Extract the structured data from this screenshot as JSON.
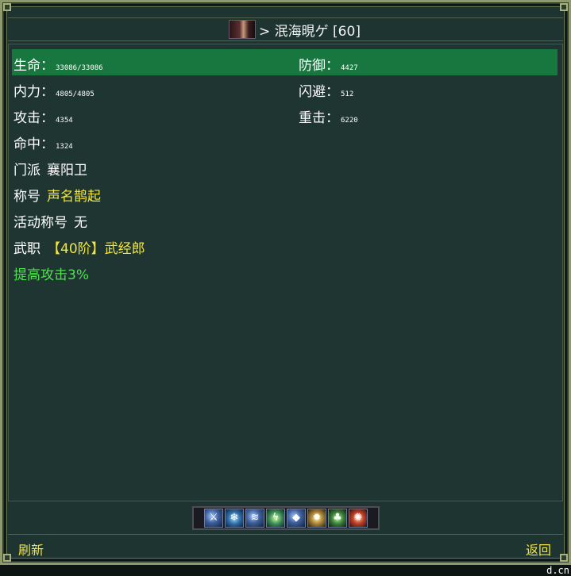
{
  "title": {
    "name": "> 泯海晛ゲ [60]"
  },
  "stats": {
    "hp_label": "生命：",
    "hp_value": "33086/33086",
    "defense_label": "防御：",
    "defense_value": "4427",
    "mp_label": "内力：",
    "mp_value": "4805/4805",
    "dodge_label": "闪避：",
    "dodge_value": "512",
    "attack_label": "攻击：",
    "attack_value": "4354",
    "crit_label": "重击：",
    "crit_value": "6220",
    "hit_label": "命中：",
    "hit_value": "1324"
  },
  "info": {
    "sect_label": "门派",
    "sect_value": "襄阳卫",
    "title_label": "称号",
    "title_value": "声名鹊起",
    "event_title_label": "活动称号",
    "event_title_value": "无",
    "rank_label": "武职",
    "rank_value": "【40阶】武经郎",
    "bonus": "提高攻击3%"
  },
  "buttons": {
    "refresh": "刷新",
    "back": "返回"
  },
  "skillbar": {
    "slots": [
      "sword-skill",
      "ice-skill",
      "wave-skill",
      "lightning-skill",
      "shield-skill",
      "gear-skill",
      "leaf-skill",
      "fire-skill"
    ]
  },
  "watermark": "d.cn",
  "colors": {
    "highlight_row": "#17773f",
    "accent_yellow": "#f3e638",
    "bonus_green": "#52e052",
    "panel_bg": "#1e3430"
  }
}
